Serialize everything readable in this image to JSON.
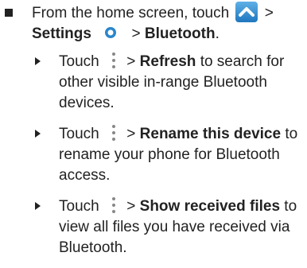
{
  "instruction": {
    "bullet_icon": "square-bullet-icon",
    "part1": "From the home screen, touch",
    "part2": ">",
    "settings_label": "Settings",
    "part3": ">",
    "bluetooth_label": "Bluetooth",
    "part4": "."
  },
  "steps": [
    {
      "touch": "Touch",
      "sep": ">",
      "action": "Refresh",
      "rest": "to search for other visible in-range Bluetooth devices."
    },
    {
      "touch": "Touch",
      "sep": ">",
      "action": "Rename this device",
      "rest": "to rename your phone for Bluetooth access."
    },
    {
      "touch": "Touch",
      "sep": ">",
      "action": "Show received files",
      "rest": "to view all files you have received via Bluetooth."
    }
  ],
  "icons": {
    "apps": "apps-up-arrow-icon",
    "settings": "settings-gear-icon",
    "menu": "vertical-dots-menu-icon"
  },
  "colors": {
    "text": "#222222",
    "apps_icon": "#2a86cc",
    "settings_icon": "#2a86cc"
  }
}
